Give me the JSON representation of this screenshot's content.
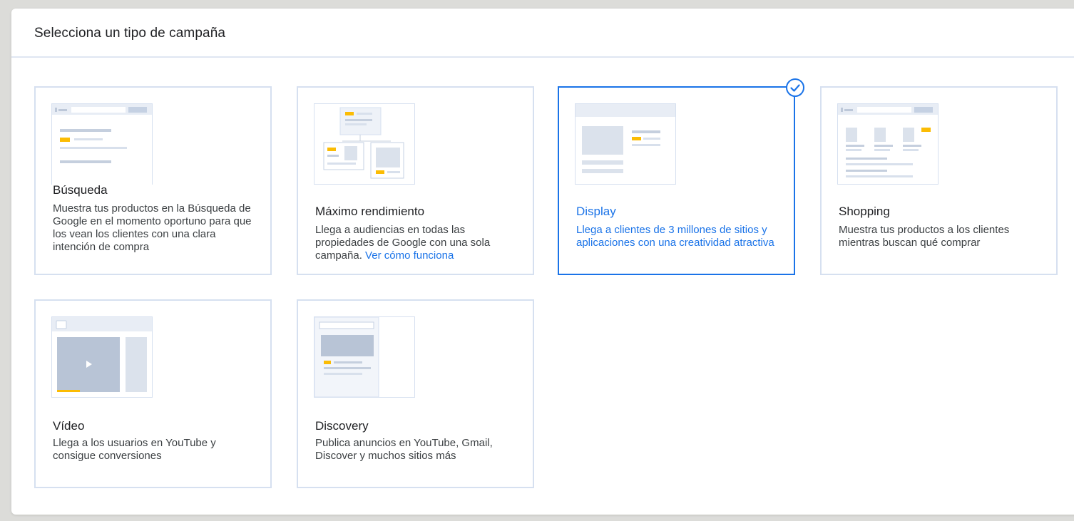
{
  "page": {
    "title": "Selecciona un tipo de campaña"
  },
  "campaigns": [
    {
      "title": "Búsqueda",
      "description": "Muestra tus productos en la Búsqueda de Google en el momento oportuno para que los vean los clientes con una clara intención de compra"
    },
    {
      "title": "Máximo rendimiento",
      "description": "Llega a audiencias en todas las propiedades de Google con una sola campaña.",
      "link": "Ver cómo funciona"
    },
    {
      "title": "Display",
      "description": "Llega a clientes de 3 millones de sitios y aplicaciones con una creatividad atractiva",
      "selected": true
    },
    {
      "title": "Shopping",
      "description": "Muestra tus productos a los clientes mientras buscan qué comprar"
    },
    {
      "title": "Vídeo",
      "description": "Llega a los usuarios en YouTube y consigue conversiones"
    },
    {
      "title": "Discovery",
      "description": "Publica anuncios en YouTube, Gmail, Discover y muchos sitios más"
    }
  ],
  "colors": {
    "accent": "#1a73e8",
    "highlight": "#fbbc04",
    "border": "#d6e0f0",
    "illustration": "#dadce0"
  },
  "icons": {
    "selected_check": "check-circle-icon"
  }
}
